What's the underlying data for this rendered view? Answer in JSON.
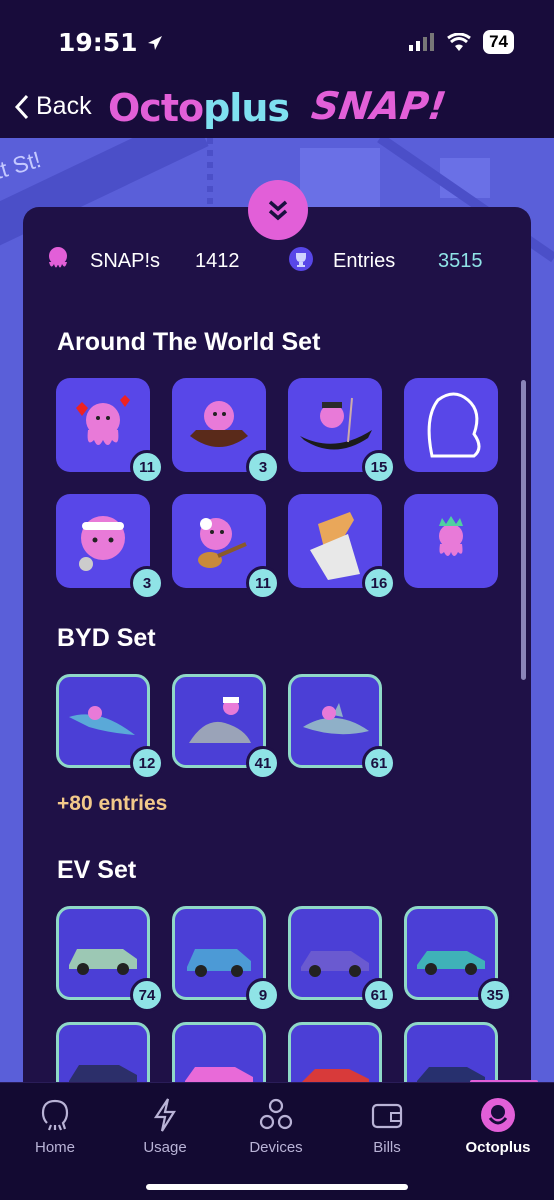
{
  "status": {
    "time": "19:51",
    "battery": "74"
  },
  "header": {
    "back_label": "Back",
    "brand_part1": "Octo",
    "brand_part2": "plus",
    "snap_logo": "SNAP!"
  },
  "map": {
    "street_label": "tt St!"
  },
  "stats": {
    "snaps_label": "SNAP!s",
    "snaps_value": "1412",
    "entries_label": "Entries",
    "entries_value": "3515"
  },
  "sets": [
    {
      "title": "Around The World Set",
      "items": [
        {
          "icon": "octopus-love-icon",
          "count": "11"
        },
        {
          "icon": "octopus-boat-icon",
          "count": "3"
        },
        {
          "icon": "octopus-gondola-icon",
          "count": "15"
        },
        {
          "icon": "locked-outline-icon",
          "count": ""
        },
        {
          "icon": "octopus-tennis-icon",
          "count": "3"
        },
        {
          "icon": "octopus-guitar-icon",
          "count": "11"
        },
        {
          "icon": "fish-and-chips-icon",
          "count": "16"
        },
        {
          "icon": "octopus-liberty-icon",
          "count": ""
        }
      ]
    },
    {
      "title": "BYD Set",
      "items": [
        {
          "icon": "octopus-dolphin-icon",
          "count": "12"
        },
        {
          "icon": "octopus-seal-icon",
          "count": "41"
        },
        {
          "icon": "octopus-shark-icon",
          "count": "61"
        }
      ],
      "bonus": "+80 entries"
    },
    {
      "title": "EV Set",
      "items": [
        {
          "icon": "green-suv-icon",
          "count": "74"
        },
        {
          "icon": "blue-hatchback-icon",
          "count": "9"
        },
        {
          "icon": "purple-ev-icon",
          "count": "61"
        },
        {
          "icon": "teal-suv-icon",
          "count": "35"
        },
        {
          "icon": "dark-suv-icon",
          "count": ""
        },
        {
          "icon": "pink-car-icon",
          "count": ""
        },
        {
          "icon": "red-sedan-icon",
          "count": ""
        },
        {
          "icon": "navy-car-icon",
          "count": ""
        }
      ]
    }
  ],
  "tabs": [
    {
      "label": "Home",
      "icon": "octopus-outline-icon"
    },
    {
      "label": "Usage",
      "icon": "lightning-icon"
    },
    {
      "label": "Devices",
      "icon": "devices-icon"
    },
    {
      "label": "Bills",
      "icon": "wallet-icon"
    },
    {
      "label": "Octoplus",
      "icon": "octoplus-icon"
    }
  ],
  "colors": {
    "accent_pink": "#e25fd8",
    "accent_cyan": "#7fe0f0",
    "tile_purple": "#5847e8",
    "background": "#180c3b"
  }
}
